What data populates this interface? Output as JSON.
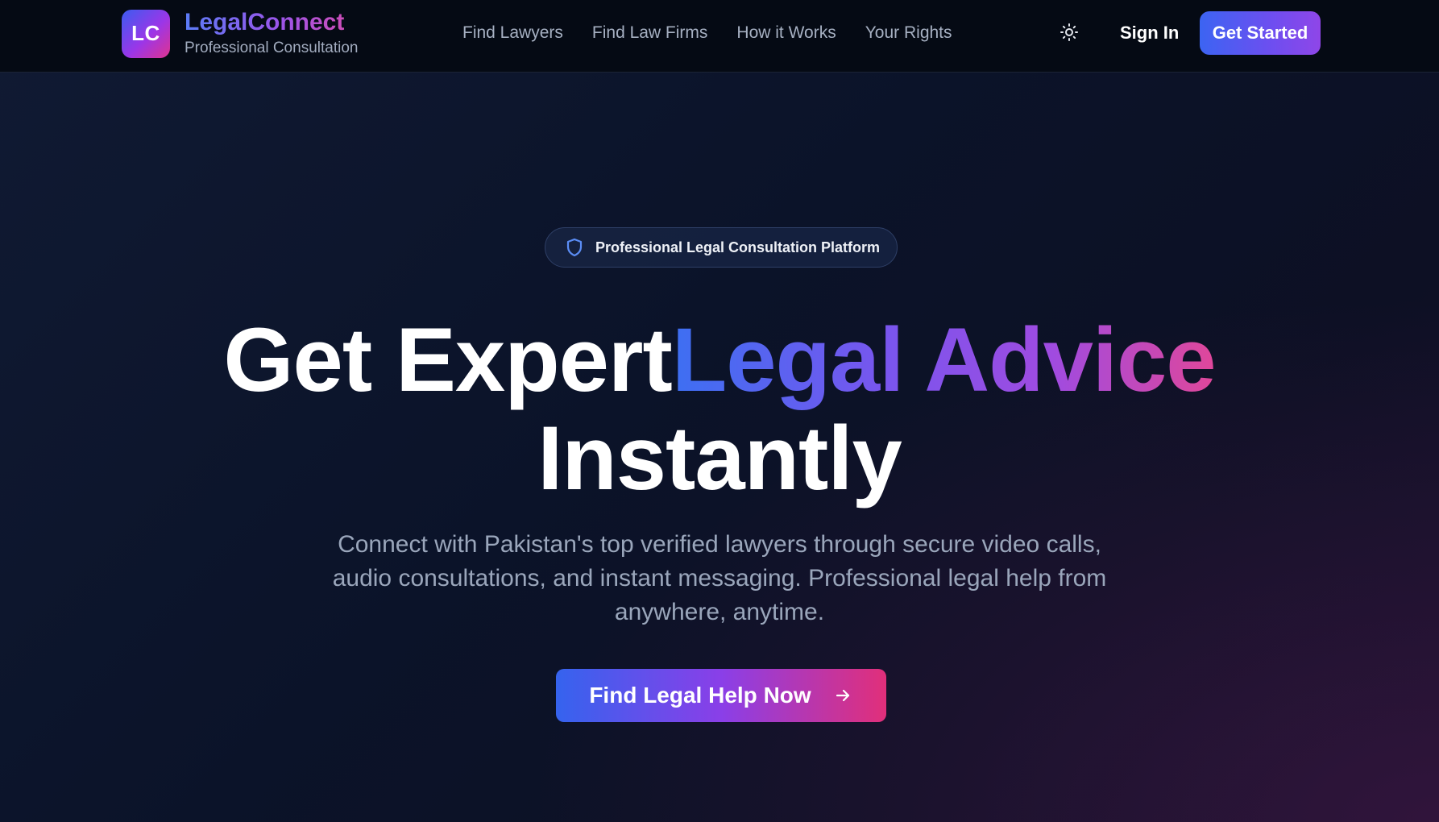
{
  "brand": {
    "logo_initials": "LC",
    "name": "LegalConnect",
    "tagline": "Professional Consultation"
  },
  "nav": {
    "links": [
      {
        "label": "Find Lawyers"
      },
      {
        "label": "Find Law Firms"
      },
      {
        "label": "How it Works"
      },
      {
        "label": "Your Rights"
      }
    ],
    "theme_toggle_icon": "sun-icon",
    "sign_in": "Sign In",
    "get_started": "Get Started"
  },
  "hero": {
    "badge_icon": "shield-icon",
    "badge_text": "Professional Legal Consultation Platform",
    "headline_part1": "Get Expert",
    "headline_highlight": "Legal Advice",
    "headline_part2": "Instantly",
    "subtitle": "Connect with Pakistan's top verified lawyers through secure video calls, audio consultations, and instant messaging. Professional legal help from anywhere, anytime.",
    "cta_label": "Find Legal Help Now",
    "cta_icon": "arrow-right-icon"
  },
  "colors": {
    "background": "#0b1222",
    "navbar": "#050a14",
    "accent_blue": "#3c64f2",
    "accent_purple": "#8f46e8",
    "accent_pink": "#e12f7a",
    "muted_text": "#9aa6bb"
  }
}
